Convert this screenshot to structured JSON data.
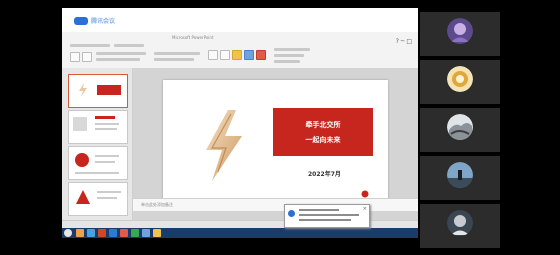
{
  "meeting": {
    "logo_text": "腾讯会议"
  },
  "ppt": {
    "window_title": "Microsoft PowerPoint",
    "help": "? ─ □",
    "notes_placeholder": "单击此处添加备注",
    "slide": {
      "line1": "牵手北交所",
      "line2": "一起向未来",
      "date": "2022年7月"
    }
  },
  "popup": {
    "title": "Windows"
  },
  "taskbar": {
    "clock": ""
  },
  "participants": [
    {
      "name": "",
      "avatar": "purple-portrait"
    },
    {
      "name": "",
      "avatar": "yellow-lion"
    },
    {
      "name": "",
      "avatar": "cloud-sky"
    },
    {
      "name": "",
      "avatar": "silhouette-landscape"
    },
    {
      "name": "",
      "avatar": "dark-blue-person"
    }
  ],
  "colors": {
    "accent_red": "#c7261e",
    "meeting_blue": "#2c6fd6",
    "panel_bg": "#2c2c2c",
    "taskbar": "#1b3b6b"
  }
}
